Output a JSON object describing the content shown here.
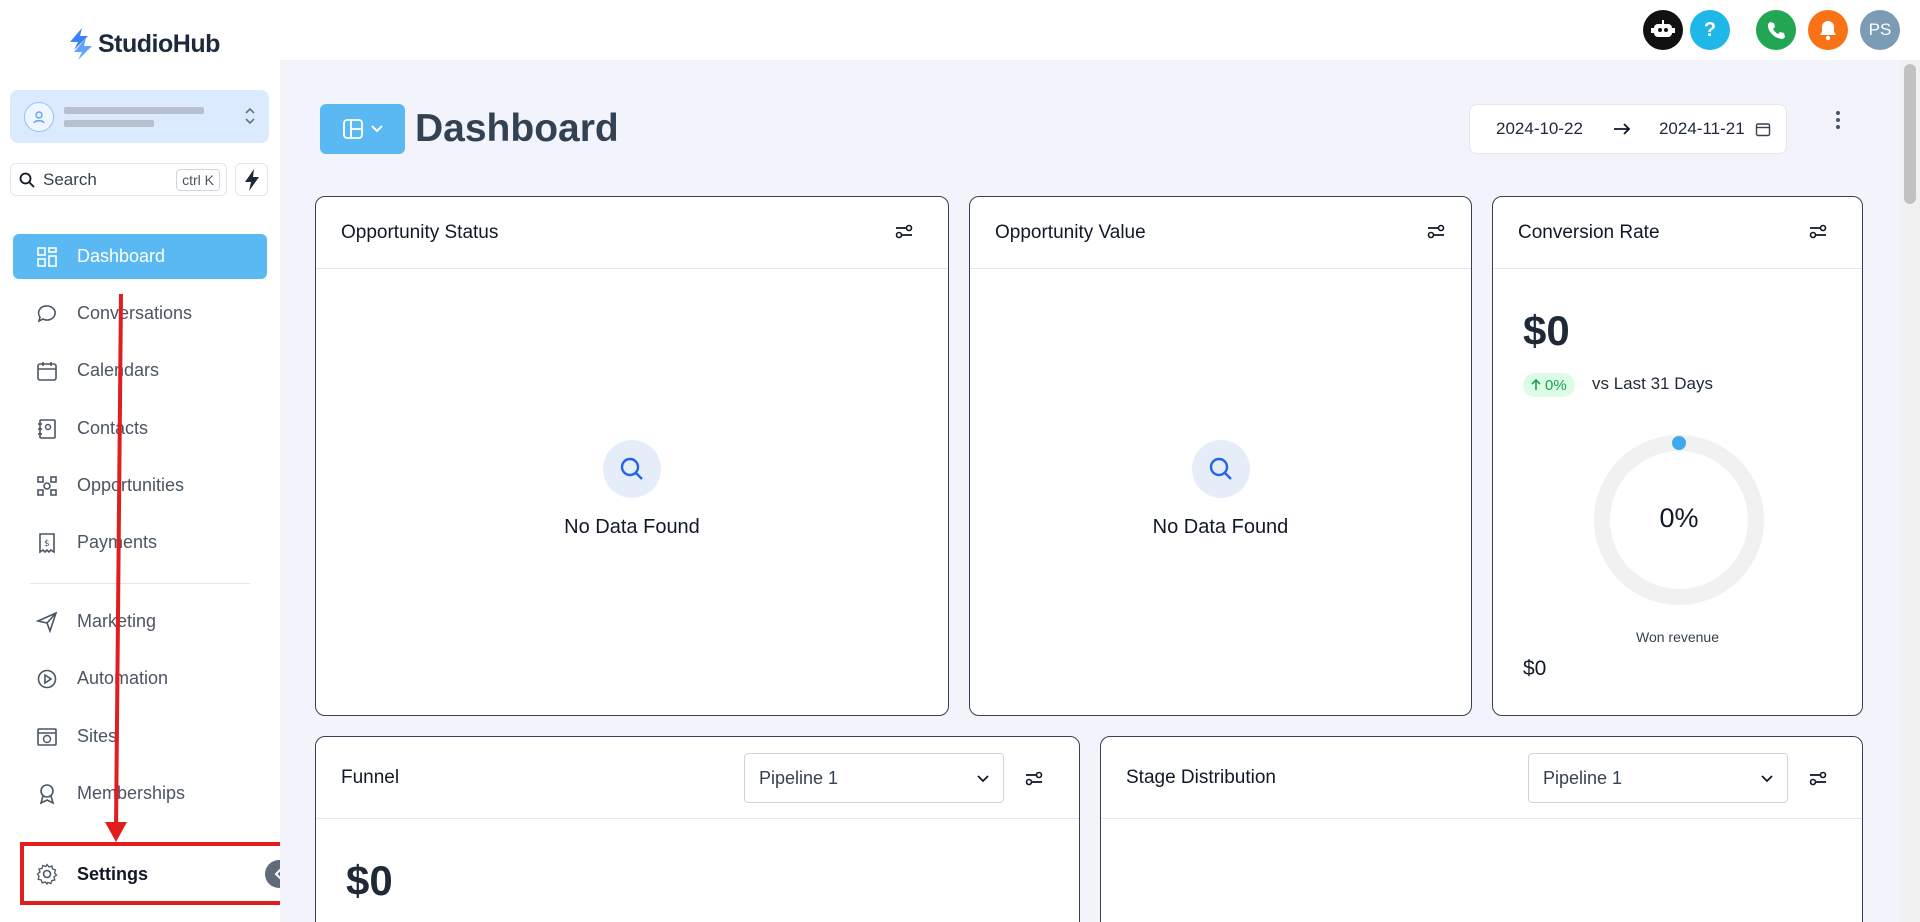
{
  "app": {
    "name": "StudioHub"
  },
  "search": {
    "label": "Search",
    "shortcut": "ctrl K"
  },
  "sidebar": {
    "items": [
      {
        "label": "Dashboard",
        "icon": "dashboard-icon"
      },
      {
        "label": "Conversations",
        "icon": "chat-icon"
      },
      {
        "label": "Calendars",
        "icon": "calendar-icon"
      },
      {
        "label": "Contacts",
        "icon": "contacts-icon"
      },
      {
        "label": "Opportunities",
        "icon": "opportunities-icon"
      },
      {
        "label": "Payments",
        "icon": "payments-icon"
      },
      {
        "label": "Marketing",
        "icon": "send-icon"
      },
      {
        "label": "Automation",
        "icon": "automation-icon"
      },
      {
        "label": "Sites",
        "icon": "sites-icon"
      },
      {
        "label": "Memberships",
        "icon": "award-icon"
      }
    ],
    "settings_label": "Settings"
  },
  "topbar": {
    "avatar_initials": "PS",
    "help_label": "?"
  },
  "page": {
    "title": "Dashboard"
  },
  "date_range": {
    "start": "2024-10-22",
    "end": "2024-11-21"
  },
  "cards": {
    "opportunity_status": {
      "title": "Opportunity Status",
      "empty": "No Data Found"
    },
    "opportunity_value": {
      "title": "Opportunity Value",
      "empty": "No Data Found"
    },
    "conversion_rate": {
      "title": "Conversion Rate",
      "value": "$0",
      "change": "0%",
      "comparison": "vs Last 31 Days",
      "gauge_value": "0%",
      "gauge_fraction": 0,
      "won_label": "Won revenue",
      "won_value": "$0"
    },
    "funnel": {
      "title": "Funnel",
      "pipeline": "Pipeline 1",
      "value": "$0"
    },
    "stage_distribution": {
      "title": "Stage Distribution",
      "pipeline": "Pipeline 1"
    }
  },
  "colors": {
    "accent": "#5ab8f2",
    "annotation": "#e11d1d"
  }
}
